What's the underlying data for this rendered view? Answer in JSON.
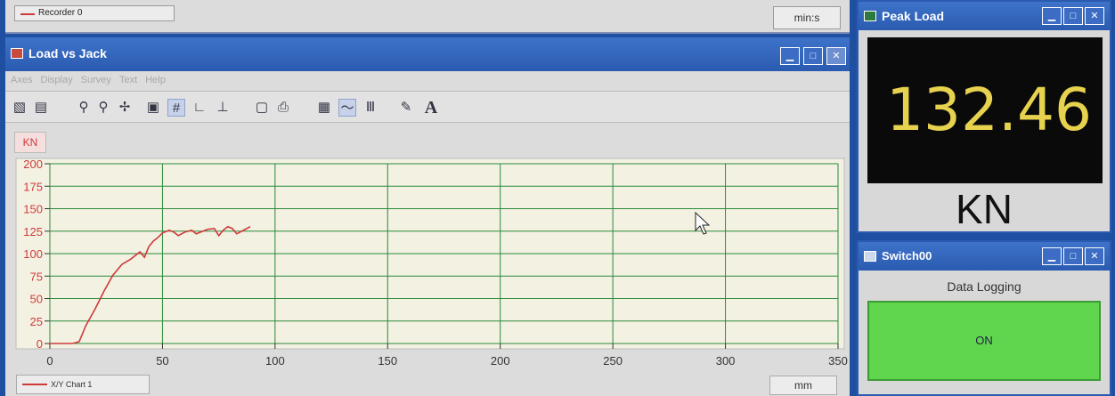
{
  "recorder": {
    "name": "Recorder 0",
    "unit": "min:s"
  },
  "chart_window": {
    "title": "Load vs Jack",
    "menu": [
      "Axes",
      "Display",
      "Survey",
      "Text",
      "Help"
    ],
    "y_unit_button": "KN",
    "x_unit": "mm",
    "legend_label": "X/Y Chart 1"
  },
  "colors": {
    "series": "#d03a3a",
    "grid": "#2a8a3a",
    "plot_bg": "#f3f1e2"
  },
  "chart_data": {
    "type": "line",
    "xlim": [
      0,
      350
    ],
    "ylim": [
      0,
      200
    ],
    "xticks": [
      0,
      50,
      100,
      150,
      200,
      250,
      300,
      350
    ],
    "yticks": [
      0,
      25,
      50,
      75,
      100,
      125,
      150,
      175,
      200
    ],
    "grid": true,
    "series": [
      {
        "x": [
          0,
          10,
          13,
          16,
          20,
          24,
          28,
          32,
          36,
          40,
          42,
          44,
          46,
          48,
          50,
          53,
          55,
          57,
          60,
          63,
          65,
          67,
          70,
          73,
          75,
          77,
          79,
          81,
          83,
          86,
          89
        ],
        "y": [
          0,
          0,
          2,
          20,
          38,
          58,
          76,
          88,
          94,
          102,
          96,
          108,
          114,
          118,
          123,
          126,
          124,
          120,
          124,
          126,
          122,
          124,
          127,
          128,
          120,
          126,
          130,
          128,
          122,
          126,
          130
        ]
      }
    ]
  },
  "peak_window": {
    "title": "Peak Load",
    "value": "132.46",
    "unit": "KN"
  },
  "switch_window": {
    "title": "Switch00",
    "label": "Data Logging",
    "state": "ON"
  }
}
